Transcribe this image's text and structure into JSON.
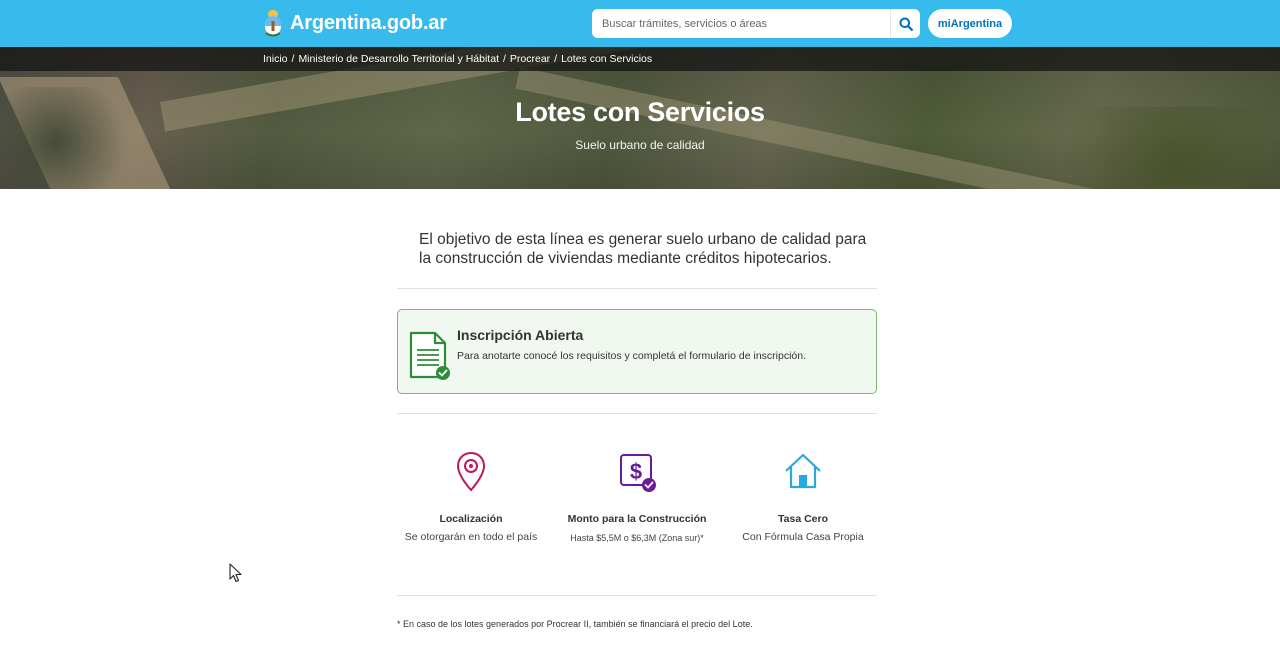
{
  "header": {
    "logo_text": "Argentina.gob.ar",
    "search_placeholder": "Buscar trámites, servicios o áreas",
    "mi_argentina_label": "miArgentina",
    "accent_color": "#37bbed"
  },
  "breadcrumb": {
    "items": [
      "Inicio",
      "Ministerio de Desarrollo Territorial y Hábitat",
      "Procrear",
      "Lotes con Servicios"
    ],
    "separator": "/"
  },
  "hero": {
    "title": "Lotes con Servicios",
    "subtitle": "Suelo urbano de calidad"
  },
  "main": {
    "lead": "El objetivo de esta línea es generar suelo urbano de calidad para la construcción de viviendas mediante créditos hipotecarios.",
    "alert": {
      "title": "Inscripción Abierta",
      "text": "Para anotarte conocé los requisitos y completá el formulario de inscripción.",
      "icon": "document-check-icon",
      "color": "#2e8b3a"
    },
    "features": [
      {
        "title": "Localización",
        "description": "Se otorgarán en todo el país",
        "icon": "location-pin-icon",
        "color": "#c2185b"
      },
      {
        "title": "Monto para la Construcción",
        "description": "Hasta $5,5M o $6,3M (Zona sur)*",
        "icon": "money-check-icon",
        "color": "#6a1b9a"
      },
      {
        "title": "Tasa Cero",
        "description": "Con Fórmula Casa Propia",
        "icon": "house-icon",
        "color": "#29a8e0"
      }
    ],
    "footnote": "* En caso de los lotes generados por Procrear II, también se financiará el precio del Lote."
  }
}
